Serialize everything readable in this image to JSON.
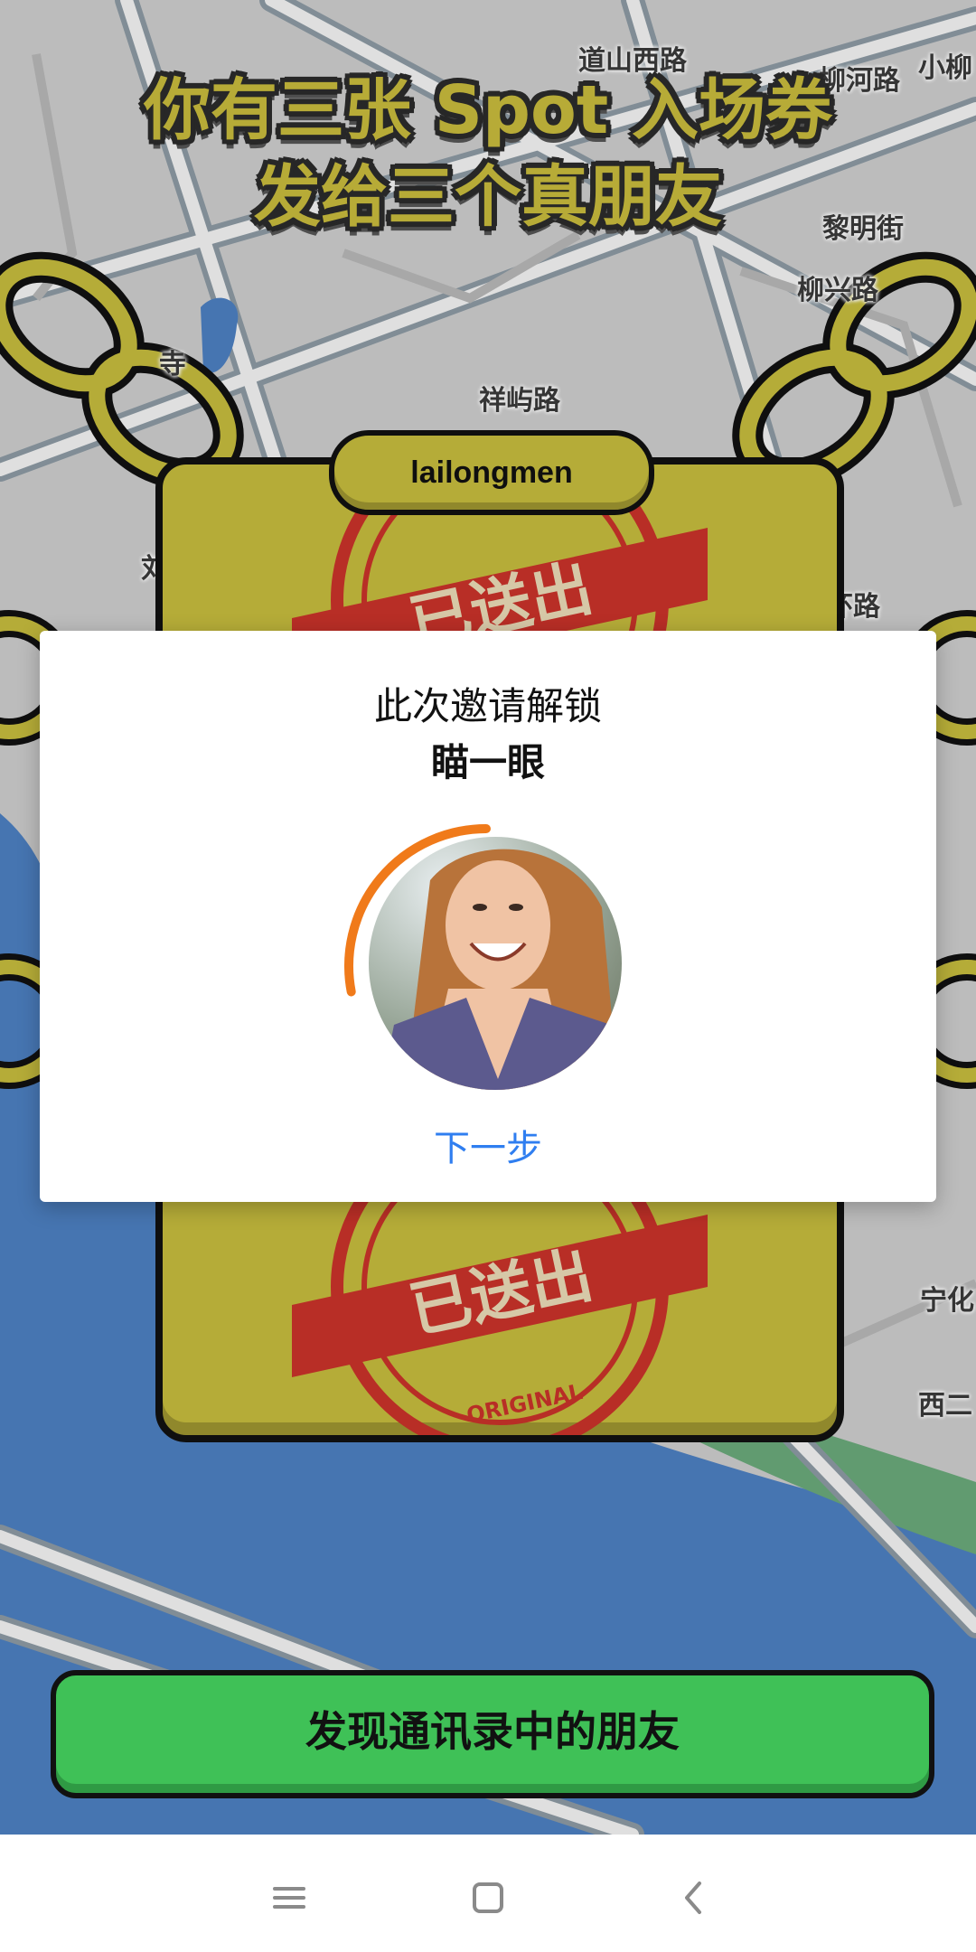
{
  "map": {
    "streets": [
      "道山西路",
      "柳河路",
      "小柳",
      "黎明街",
      "柳兴路",
      "祥屿路",
      "寺",
      "环路",
      "宁化",
      "西二",
      "刘"
    ]
  },
  "headline": {
    "line1": "你有三张 Spot 入场券",
    "line2": "发给三个真朋友"
  },
  "ticket": {
    "username": "lailongmen",
    "stamp_text": "已送出",
    "stamp_subtext": "ORIGINAL"
  },
  "modal": {
    "title": "此次邀请解锁",
    "subtitle": "瞄一眼",
    "next_label": "下一步",
    "progress_fraction": 0.28,
    "progress_color": "#f07a1a"
  },
  "cta": {
    "label": "发现通讯录中的朋友",
    "color": "#3fc157"
  },
  "navbar": {
    "menu_icon": "menu-icon",
    "home_icon": "home-square-icon",
    "back_icon": "back-chevron-icon"
  }
}
